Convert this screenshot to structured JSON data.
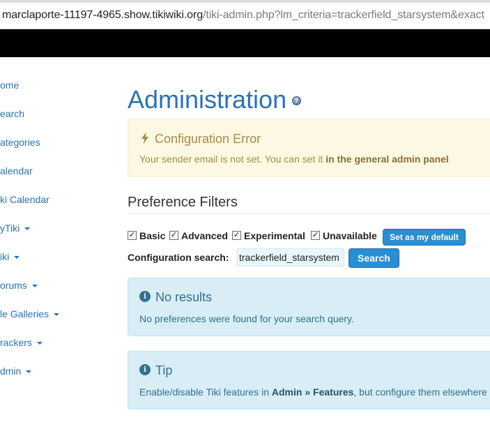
{
  "browser": {
    "url_host": "marclaporte-11197-4965.show.tikiwiki.org",
    "url_path": "/tiki-admin.php?lm_criteria=trackerfield_starsystem&exact"
  },
  "sidebar": {
    "items": [
      {
        "label": "ome",
        "dropdown": false
      },
      {
        "label": "earch",
        "dropdown": false
      },
      {
        "label": "ategories",
        "dropdown": false
      },
      {
        "label": "alendar",
        "dropdown": false
      },
      {
        "label": "ki Calendar",
        "dropdown": false
      },
      {
        "label": "yTiki",
        "dropdown": true
      },
      {
        "label": "iki",
        "dropdown": true
      },
      {
        "label": "orums",
        "dropdown": true
      },
      {
        "label": "le Galleries",
        "dropdown": true
      },
      {
        "label": "rackers",
        "dropdown": true
      },
      {
        "label": "dmin",
        "dropdown": true
      }
    ]
  },
  "page": {
    "title": "Administration",
    "help_icon": "help-icon"
  },
  "config_error": {
    "icon": "lightning-bolt-icon",
    "heading": "Configuration Error",
    "text": "Your sender email is not set. You can set it",
    "link": "in the general admin panel"
  },
  "preference_filters": {
    "heading": "Preference Filters",
    "filters": [
      {
        "label": "Basic",
        "checked": true
      },
      {
        "label": "Advanced",
        "checked": true
      },
      {
        "label": "Experimental",
        "checked": true
      },
      {
        "label": "Unavailable",
        "checked": true
      }
    ],
    "default_button": "Set as my default",
    "search_label": "Configuration search:",
    "search_value": "trackerfield_starsystem",
    "search_button": "Search"
  },
  "no_results": {
    "icon": "info-icon",
    "heading": "No results",
    "text": "No preferences were found for your search query."
  },
  "tip": {
    "icon": "info-icon",
    "heading": "Tip",
    "text_prefix": "Enable/disable Tiki features in",
    "admin": "Admin",
    "separator": "»",
    "features": "Features",
    "text_suffix": ", but configure them elsewhere"
  },
  "colors": {
    "link": "#2a72b5",
    "button": "#2a8ed0",
    "warning_bg": "#fcf8e3",
    "info_bg": "#d9edf7"
  }
}
